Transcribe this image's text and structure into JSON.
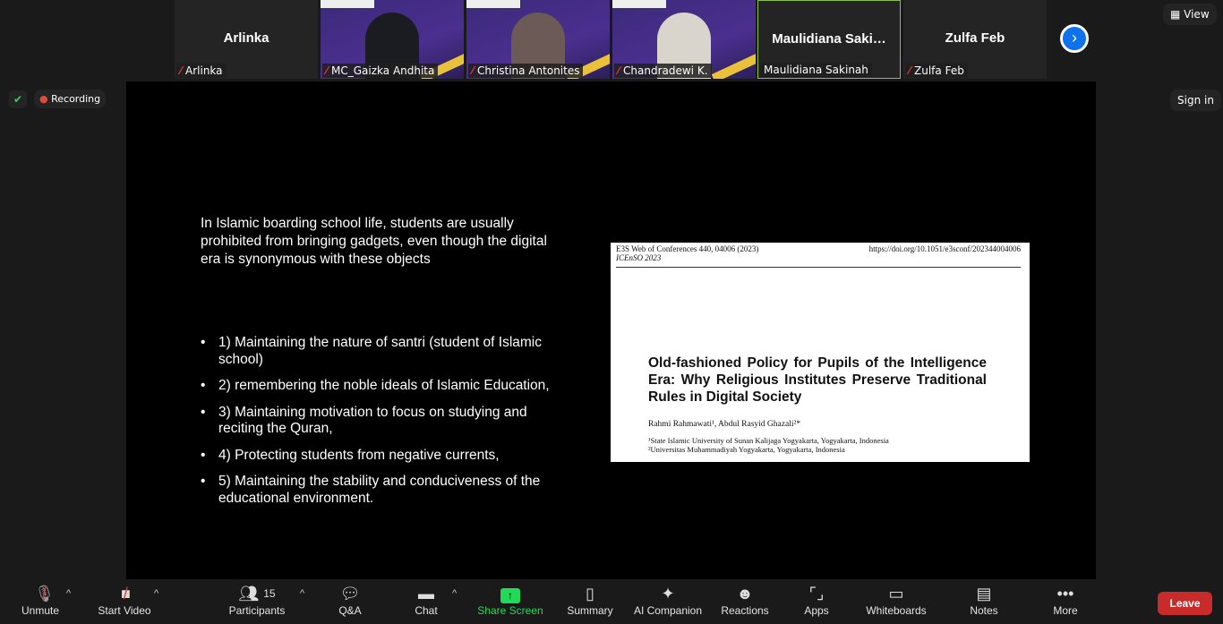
{
  "tiles": [
    {
      "big": "Arlinka",
      "name": "Arlinka",
      "muted": true,
      "video": false
    },
    {
      "name": "MC_Gaizka Andhita",
      "muted": true,
      "video": true
    },
    {
      "name": "Christina Antonites",
      "muted": true,
      "video": true
    },
    {
      "name": "Chandradewi K.",
      "muted": true,
      "video": true
    },
    {
      "big": "Maulidiana  Saki…",
      "name": "Maulidiana Sakinah",
      "muted": false,
      "video": false
    },
    {
      "big": "Zulfa Feb",
      "name": "Zulfa Feb",
      "muted": true,
      "video": false
    }
  ],
  "top": {
    "view": "View",
    "recording": "Recording",
    "sign_in": "Sign in"
  },
  "slide": {
    "intro": "In Islamic boarding school life, students are usually prohibited from bringing gadgets, even though the digital era is synonymous with these objects",
    "bullets": [
      "1) Maintaining the nature of santri (student of Islamic school)",
      "2) remembering the noble ideals of Islamic Education,",
      "3) Maintaining motivation to focus on studying and reciting the Quran,",
      "4) Protecting students from negative currents,",
      "5) Maintaining the stability and conduciveness of the educational environment."
    ],
    "paper": {
      "journal": "E3S Web of Conferences 440, 04006 (2023)",
      "conference": "ICEnSO 2023",
      "doi": "https://doi.org/10.1051/e3sconf/202344004006",
      "title": "Old-fashioned Policy for Pupils of the Intelligence Era: Why Religious Institutes Preserve Traditional Rules in Digital Society",
      "authors": "Rahmi Rahmawati¹, Abdul Rasyid Ghazali²*",
      "aff1": "¹State Islamic University of Sunan Kalijaga Yogyakarta, Yogyakarta, Indonesia",
      "aff2": "²Universitas Muhammadiyah Yogyakarta, Yogyakarta, Indonesia"
    }
  },
  "toolbar": {
    "unmute": "Unmute",
    "start_video": "Start Video",
    "participants": "Participants",
    "participant_count": "15",
    "qa": "Q&A",
    "chat": "Chat",
    "share": "Share Screen",
    "summary": "Summary",
    "ai": "AI Companion",
    "reactions": "Reactions",
    "apps": "Apps",
    "whiteboards": "Whiteboards",
    "notes": "Notes",
    "more": "More",
    "leave": "Leave"
  },
  "colors": {
    "share_green": "#23d959",
    "leave_red": "#c92a2a",
    "accent_blue": "#0e72ed"
  }
}
